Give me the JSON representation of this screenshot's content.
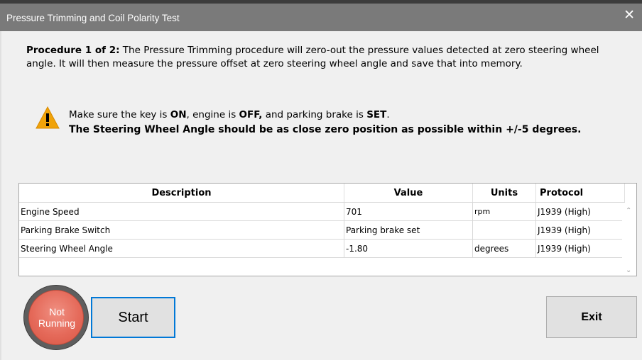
{
  "window": {
    "title": "Pressure Trimming and Coil Polarity Test",
    "close_symbol": "✕"
  },
  "procedure": {
    "label": "Procedure 1 of 2:",
    "text": " The Pressure Trimming procedure will zero-out the pressure values detected at zero steering wheel angle. It will then measure the pressure offset at zero steering wheel angle and save that into memory."
  },
  "warning": {
    "icon": "warning-triangle-icon",
    "line1_a": "Make sure the key is ",
    "line1_b": "ON",
    "line1_c": ", engine is ",
    "line1_d": "OFF,",
    "line1_e": " and parking brake is ",
    "line1_f": "SET",
    "line1_g": ".",
    "line2": "The Steering Wheel Angle should be as close zero position as possible within +/-5 degrees."
  },
  "table": {
    "headers": {
      "description": "Description",
      "value": "Value",
      "units": "Units",
      "protocol": "Protocol"
    },
    "rows": [
      {
        "description": "Engine Speed",
        "value": "701",
        "units": "rpm",
        "protocol": "J1939 (High)"
      },
      {
        "description": "Parking Brake Switch",
        "value": "Parking brake set",
        "units": "",
        "protocol": "J1939 (High)"
      },
      {
        "description": "Steering Wheel Angle",
        "value": "-1.80",
        "units": "degrees",
        "protocol": "J1939 (High)"
      }
    ]
  },
  "status": {
    "line1": "Not",
    "line2": "Running",
    "color": "#e56a5a"
  },
  "buttons": {
    "start": "Start",
    "exit": "Exit"
  },
  "colors": {
    "titlebar": "#7a7a7a",
    "focus_border": "#0078d7",
    "warning_icon": "#f0a30a"
  }
}
